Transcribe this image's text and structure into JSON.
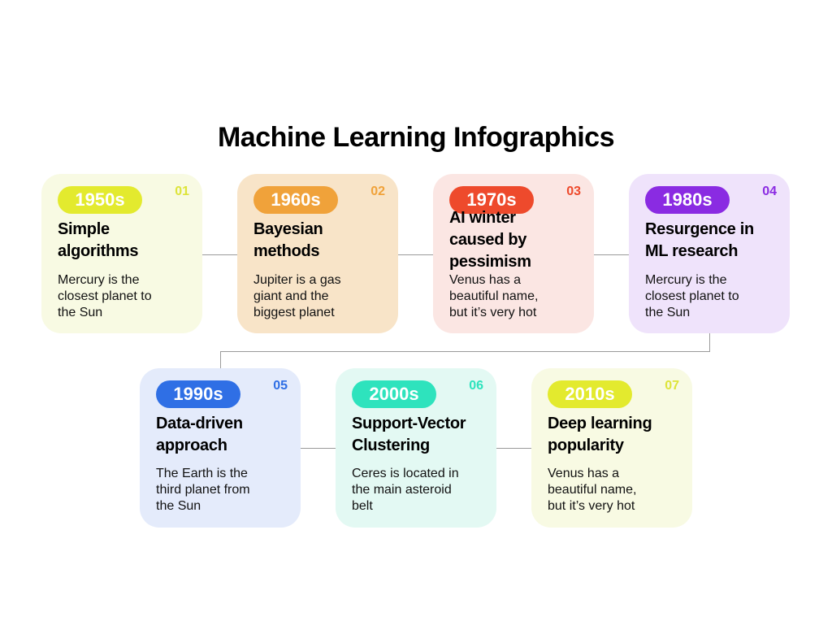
{
  "title": "Machine Learning Infographics",
  "colors": {
    "yellow": "#e3ea2e",
    "orange": "#f0a23a",
    "red": "#ee4a2c",
    "purple": "#8a2be2",
    "blue": "#2f6fe5",
    "teal": "#2ee3bd",
    "connector": "#9a9a9a"
  },
  "cards": [
    {
      "number": "01",
      "decade": "1950s",
      "title": "Simple algorithms",
      "description": "Mercury is the closest planet to the Sun",
      "accent": "#e3ea2e",
      "background": "#f8fae3",
      "number_color": "#dde43a"
    },
    {
      "number": "02",
      "decade": "1960s",
      "title": "Bayesian methods",
      "description": "Jupiter is a gas giant and the biggest planet",
      "accent": "#f0a23a",
      "background": "#f8e4c8",
      "number_color": "#f0a23a"
    },
    {
      "number": "03",
      "decade": "1970s",
      "title": "AI winter caused by pessimism",
      "description": "Venus has a beautiful name, but it’s very hot",
      "accent": "#ee4a2c",
      "background": "#fbe6e3",
      "number_color": "#ee4a2c"
    },
    {
      "number": "04",
      "decade": "1980s",
      "title": "Resurgence in ML research",
      "description": "Mercury is the closest planet to the Sun",
      "accent": "#8a2be2",
      "background": "#efe3fb",
      "number_color": "#8a2be2"
    },
    {
      "number": "05",
      "decade": "1990s",
      "title": "Data-driven approach",
      "description": "The Earth is the third planet from the Sun",
      "accent": "#2f6fe5",
      "background": "#e4ebfb",
      "number_color": "#2f6fe5"
    },
    {
      "number": "06",
      "decade": "2000s",
      "title": "Support-Vector Clustering",
      "description": "Ceres is located in the main asteroid belt",
      "accent": "#2ee3bd",
      "background": "#e3f9f3",
      "number_color": "#2ee3bd"
    },
    {
      "number": "07",
      "decade": "2010s",
      "title": "Deep learning popularity",
      "description": "Venus has a beautiful name, but it’s very hot",
      "accent": "#e3ea2e",
      "background": "#f8fae3",
      "number_color": "#dde43a"
    }
  ]
}
